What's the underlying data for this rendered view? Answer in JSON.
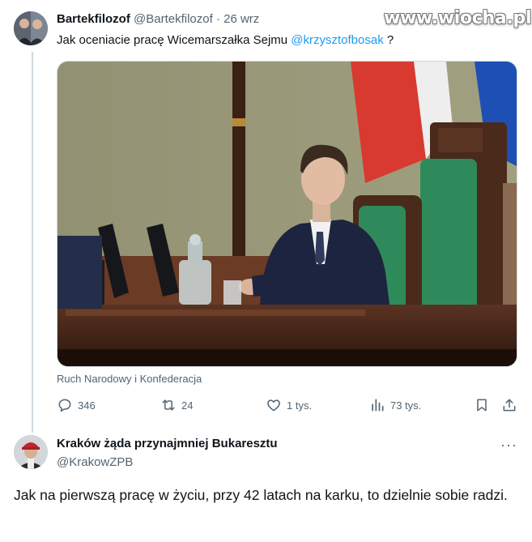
{
  "watermark": "www.wiocha.pl",
  "tweet": {
    "author_name": "Bartekfilozof",
    "author_handle": "@Bartekfilozof",
    "separator": "·",
    "date": "26 wrz",
    "text_before": "Jak oceniacie pracę Wicemarszałka Sejmu ",
    "mention": "@krzysztofbosak",
    "text_after": " ?",
    "media_caption": "Ruch Narodowy i Konfederacja",
    "actions": {
      "replies": "346",
      "reposts": "24",
      "likes": "1 tys.",
      "views": "73 tys."
    },
    "icons": {
      "reply": "speech-bubble-icon",
      "repost": "repost-arrows-icon",
      "like": "heart-icon",
      "views": "bar-chart-icon",
      "bookmark": "bookmark-icon",
      "share": "share-upload-icon"
    }
  },
  "reply": {
    "author_name": "Kraków żąda przynajmniej Bukaresztu",
    "author_handle": "@KrakowZPB",
    "more": "···",
    "text": "Jak na pierwszą pracę w życiu, przy 42 latach na karku, to dzielnie sobie radzi."
  },
  "colors": {
    "accent_blue": "#1d9bf0",
    "muted_text": "#536471",
    "chair_green": "#2f8a5b",
    "wood": "#4a2a1a"
  }
}
